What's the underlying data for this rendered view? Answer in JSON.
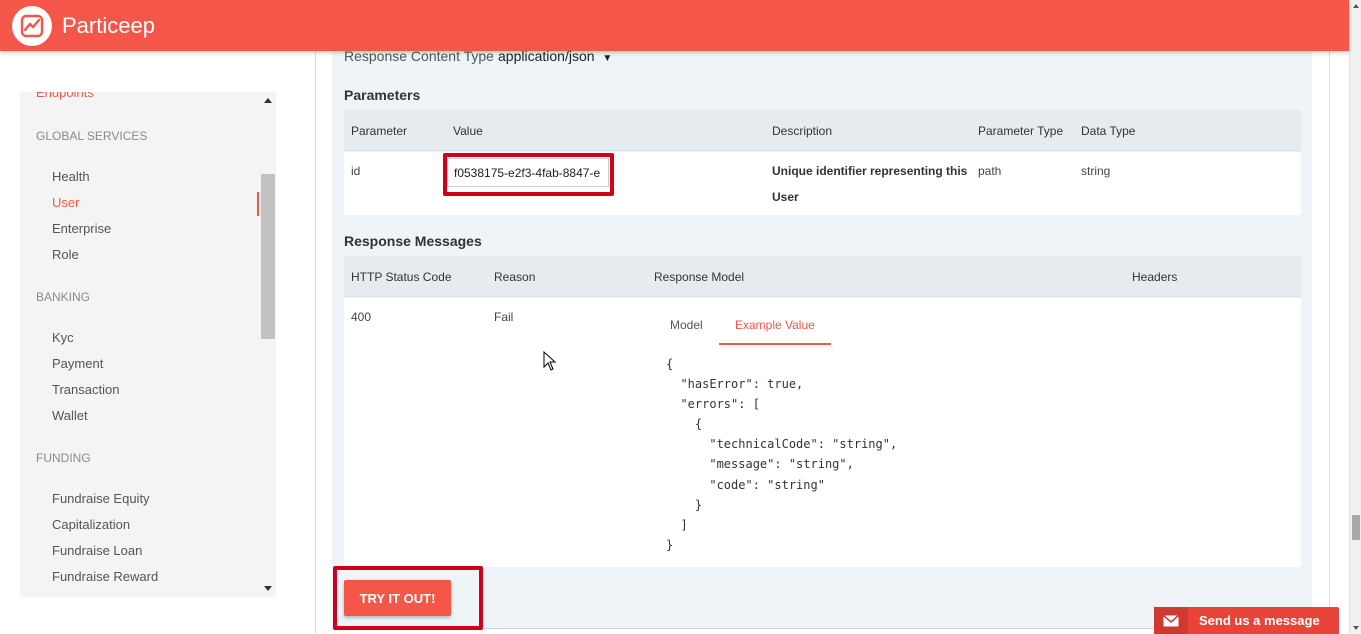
{
  "header": {
    "brand": "Particeep"
  },
  "sidebar": {
    "endpoints_label": "Endpoints",
    "sections": [
      {
        "title": "GLOBAL SERVICES",
        "items": [
          "Health",
          "User",
          "Enterprise",
          "Role"
        ]
      },
      {
        "title": "BANKING",
        "items": [
          "Kyc",
          "Payment",
          "Transaction",
          "Wallet"
        ]
      },
      {
        "title": "FUNDING",
        "items": [
          "Fundraise Equity",
          "Capitalization",
          "Fundraise Loan",
          "Fundraise Reward"
        ]
      }
    ],
    "active_item": "User"
  },
  "operation": {
    "response_content_type_label": "Response Content Type",
    "response_content_type_value": "application/json",
    "parameters_title": "Parameters",
    "parameters_headers": [
      "Parameter",
      "Value",
      "Description",
      "Parameter Type",
      "Data Type"
    ],
    "parameter_row": {
      "name": "id",
      "value": "f0538175-e2f3-4fab-8847-e",
      "description_line1": "Unique identifier representing this",
      "description_line2": "User",
      "param_type": "path",
      "data_type": "string"
    },
    "response_messages_title": "Response Messages",
    "response_headers": [
      "HTTP Status Code",
      "Reason",
      "Response Model",
      "Headers"
    ],
    "response_row": {
      "status_code": "400",
      "reason": "Fail",
      "tabs": [
        "Model",
        "Example Value"
      ],
      "active_tab": "Example Value",
      "example_value": "{\n  \"hasError\": true,\n  \"errors\": [\n    {\n      \"technicalCode\": \"string\",\n      \"message\": \"string\",\n      \"code\": \"string\"\n    }\n  ]\n}"
    },
    "try_button_label": "TRY IT OUT!"
  },
  "chat_widget": {
    "label": "Send us a message"
  },
  "colors": {
    "brand": "#f5564a",
    "highlight_box": "#d0021b",
    "operation_bg": "#eef4f8"
  }
}
